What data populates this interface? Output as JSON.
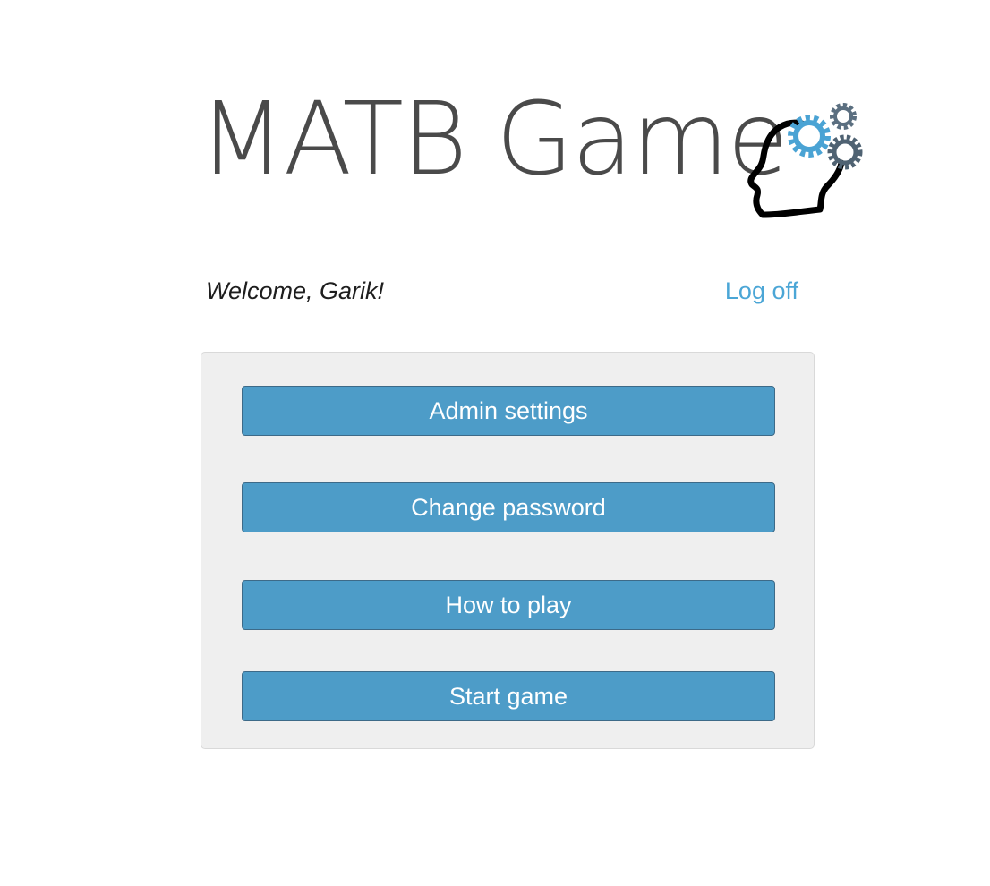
{
  "header": {
    "app_title": "MATB Game",
    "logo_icon": "head-with-gears-icon",
    "colors": {
      "title": "#4a4a4a",
      "gear_blue": "#4aa3d4",
      "gear_gray": "#5b6f80"
    }
  },
  "user_bar": {
    "welcome_text": "Welcome, Garik!",
    "logoff_label": "Log off",
    "link_color": "#4ba6d6"
  },
  "menu": {
    "button_color": "#4d9cc8",
    "items": [
      {
        "label": "Admin settings"
      },
      {
        "label": "Change password"
      },
      {
        "label": "How to play"
      },
      {
        "label": "Start game"
      }
    ]
  }
}
